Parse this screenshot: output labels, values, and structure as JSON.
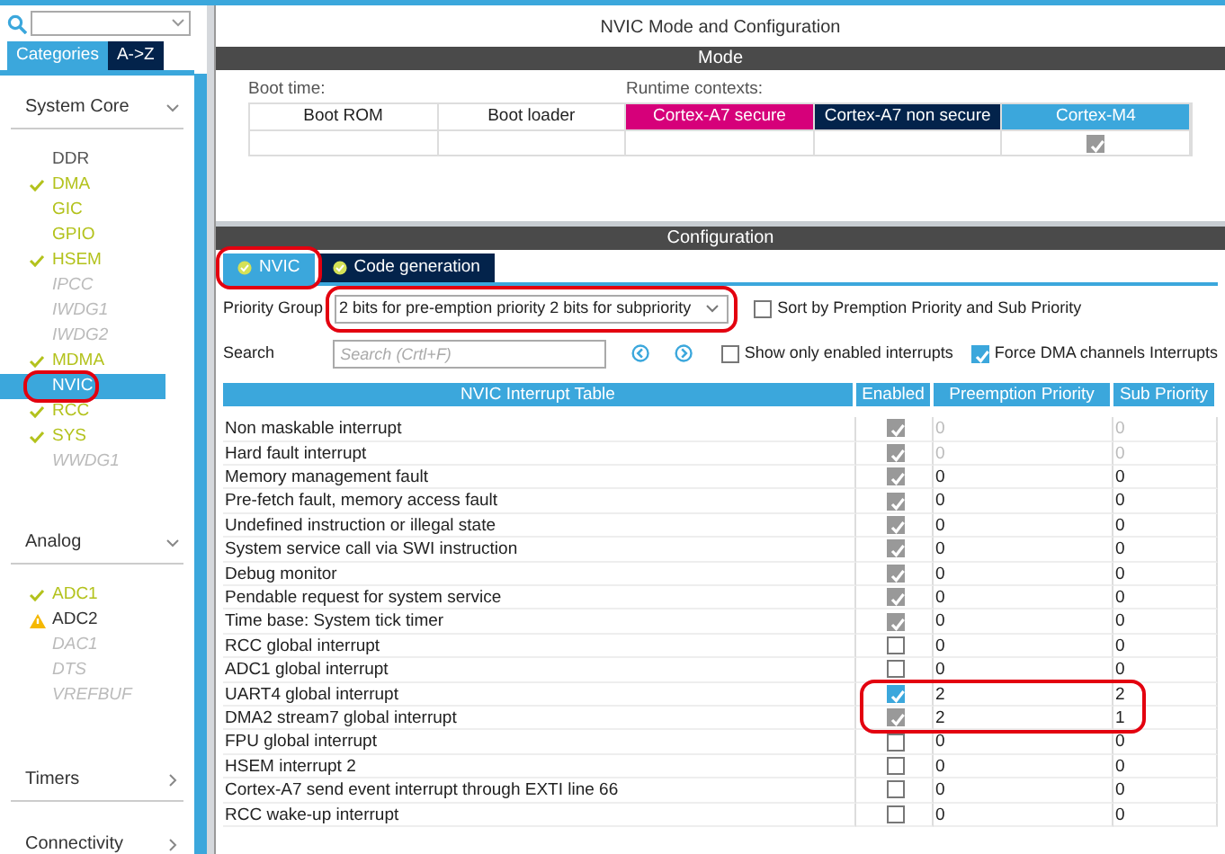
{
  "sidebar": {
    "tabs": [
      {
        "label": "Categories",
        "selected": true
      },
      {
        "label": "A->Z",
        "selected": false
      }
    ],
    "groups": [
      {
        "title": "System Core",
        "expanded": true,
        "items": [
          {
            "label": "DDR",
            "kind": "none",
            "selected": false,
            "circled": false
          },
          {
            "label": "DMA",
            "kind": "configured",
            "selected": false,
            "circled": false
          },
          {
            "label": "GIC",
            "kind": "available",
            "selected": false,
            "circled": false
          },
          {
            "label": "GPIO",
            "kind": "available",
            "selected": false,
            "circled": false
          },
          {
            "label": "HSEM",
            "kind": "configured",
            "selected": false,
            "circled": false
          },
          {
            "label": "IPCC",
            "kind": "disabled",
            "selected": false,
            "circled": false
          },
          {
            "label": "IWDG1",
            "kind": "disabled",
            "selected": false,
            "circled": false
          },
          {
            "label": "IWDG2",
            "kind": "disabled",
            "selected": false,
            "circled": false
          },
          {
            "label": "MDMA",
            "kind": "configured",
            "selected": false,
            "circled": false
          },
          {
            "label": "NVIC",
            "kind": "available",
            "selected": true,
            "circled": true
          },
          {
            "label": "RCC",
            "kind": "configured",
            "selected": false,
            "circled": false
          },
          {
            "label": "SYS",
            "kind": "configured",
            "selected": false,
            "circled": false
          },
          {
            "label": "WWDG1",
            "kind": "disabled",
            "selected": false,
            "circled": false
          }
        ]
      },
      {
        "title": "Analog",
        "expanded": true,
        "items": [
          {
            "label": "ADC1",
            "kind": "configured",
            "selected": false,
            "circled": false
          },
          {
            "label": "ADC2",
            "kind": "warning",
            "selected": false,
            "circled": false
          },
          {
            "label": "DAC1",
            "kind": "disabled",
            "selected": false,
            "circled": false
          },
          {
            "label": "DTS",
            "kind": "disabled",
            "selected": false,
            "circled": false
          },
          {
            "label": "VREFBUF",
            "kind": "disabled",
            "selected": false,
            "circled": false
          }
        ]
      },
      {
        "title": "Timers",
        "expanded": false
      },
      {
        "title": "Connectivity",
        "expanded": false
      }
    ]
  },
  "main": {
    "title": "NVIC Mode and Configuration",
    "mode": {
      "header": "Mode",
      "boot_label": "Boot time:",
      "runtime_label": "Runtime contexts:",
      "columns": [
        {
          "label": "Boot ROM",
          "color": "#ffffff",
          "checked": false
        },
        {
          "label": "Boot loader",
          "color": "#ffffff",
          "checked": false
        },
        {
          "label": "Cortex-A7 secure",
          "color": "#d6007a",
          "checked": false
        },
        {
          "label": "Cortex-A7 non secure",
          "color": "#03234b",
          "checked": false
        },
        {
          "label": "Cortex-M4",
          "color": "#3ba7dc",
          "checked": true
        }
      ]
    },
    "configuration": {
      "header": "Configuration",
      "tabs": [
        {
          "label": "NVIC",
          "selected": true,
          "circled": true
        },
        {
          "label": "Code generation",
          "selected": false,
          "circled": false
        }
      ],
      "priority_group": {
        "label": "Priority Group",
        "value": "2 bits for pre-emption priority 2 bits for subpriority",
        "circled": true
      },
      "sort_option": {
        "label": "Sort by Premption Priority and Sub Priority",
        "checked": false
      },
      "search": {
        "label": "Search",
        "placeholder": "Search (Crtl+F)"
      },
      "filters": [
        {
          "label": "Show only enabled interrupts",
          "checked": false
        },
        {
          "label": "Force DMA channels Interrupts",
          "checked": true
        }
      ],
      "table": {
        "columns": [
          "NVIC Interrupt Table",
          "Enabled",
          "Preemption Priority",
          "Sub Priority"
        ],
        "rows": [
          {
            "name": "Non maskable interrupt",
            "enabled": true,
            "locked": true,
            "preemption": "0",
            "sub": "0",
            "values_disabled": true,
            "circled": false
          },
          {
            "name": "Hard fault interrupt",
            "enabled": true,
            "locked": true,
            "preemption": "0",
            "sub": "0",
            "values_disabled": true,
            "circled": false
          },
          {
            "name": "Memory management fault",
            "enabled": true,
            "locked": true,
            "preemption": "0",
            "sub": "0",
            "values_disabled": false,
            "circled": false
          },
          {
            "name": "Pre-fetch fault, memory access fault",
            "enabled": true,
            "locked": true,
            "preemption": "0",
            "sub": "0",
            "values_disabled": false,
            "circled": false
          },
          {
            "name": "Undefined instruction or illegal state",
            "enabled": true,
            "locked": true,
            "preemption": "0",
            "sub": "0",
            "values_disabled": false,
            "circled": false
          },
          {
            "name": "System service call via SWI instruction",
            "enabled": true,
            "locked": true,
            "preemption": "0",
            "sub": "0",
            "values_disabled": false,
            "circled": false
          },
          {
            "name": "Debug monitor",
            "enabled": true,
            "locked": true,
            "preemption": "0",
            "sub": "0",
            "values_disabled": false,
            "circled": false
          },
          {
            "name": "Pendable request for system service",
            "enabled": true,
            "locked": true,
            "preemption": "0",
            "sub": "0",
            "values_disabled": false,
            "circled": false
          },
          {
            "name": "Time base: System tick timer",
            "enabled": true,
            "locked": true,
            "preemption": "0",
            "sub": "0",
            "values_disabled": false,
            "circled": false
          },
          {
            "name": "RCC global interrupt",
            "enabled": false,
            "locked": false,
            "preemption": "0",
            "sub": "0",
            "values_disabled": false,
            "circled": false
          },
          {
            "name": "ADC1 global interrupt",
            "enabled": false,
            "locked": false,
            "preemption": "0",
            "sub": "0",
            "values_disabled": false,
            "circled": false
          },
          {
            "name": "UART4 global interrupt",
            "enabled": true,
            "locked": false,
            "preemption": "2",
            "sub": "2",
            "values_disabled": false,
            "circled": true
          },
          {
            "name": "DMA2 stream7 global interrupt",
            "enabled": true,
            "locked": true,
            "preemption": "2",
            "sub": "1",
            "values_disabled": false,
            "circled": true
          },
          {
            "name": "FPU global interrupt",
            "enabled": false,
            "locked": false,
            "preemption": "0",
            "sub": "0",
            "values_disabled": false,
            "circled": false
          },
          {
            "name": "HSEM interrupt 2",
            "enabled": false,
            "locked": false,
            "preemption": "0",
            "sub": "0",
            "values_disabled": false,
            "circled": false
          },
          {
            "name": "Cortex-A7 send event interrupt through EXTI line 66",
            "enabled": false,
            "locked": false,
            "preemption": "0",
            "sub": "0",
            "values_disabled": false,
            "circled": false
          },
          {
            "name": "RCC wake-up interrupt",
            "enabled": false,
            "locked": false,
            "preemption": "0",
            "sub": "0",
            "values_disabled": false,
            "circled": false
          }
        ]
      }
    }
  }
}
